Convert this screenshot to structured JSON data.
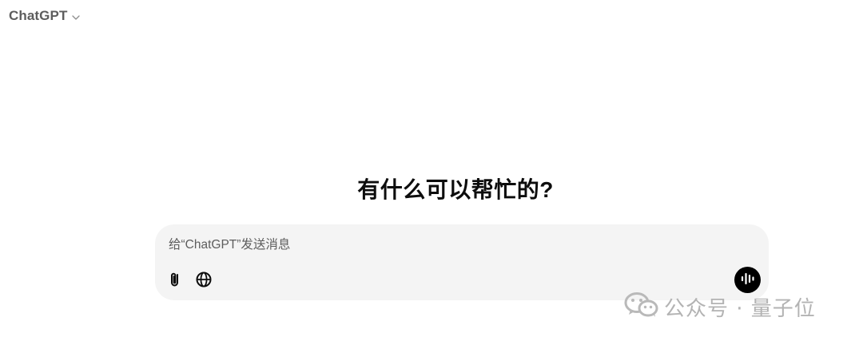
{
  "header": {
    "model_name": "ChatGPT",
    "model_menu_icon": "chevron-down-icon"
  },
  "main": {
    "headline": "有什么可以帮忙的?"
  },
  "composer": {
    "placeholder": "给“ChatGPT”发送消息",
    "value": "",
    "attach_icon": "paperclip-icon",
    "search_icon": "globe-icon",
    "voice_icon": "voice-mode-icon"
  },
  "watermark": {
    "icon": "wechat-icon",
    "text": "公众号 · 量子位"
  },
  "colors": {
    "background": "#ffffff",
    "composer_bg": "#f4f4f4",
    "text_primary": "#0d0d0d",
    "text_secondary": "#5d5d5d",
    "voice_button_bg": "#000000",
    "watermark": "#b3b3b3"
  }
}
